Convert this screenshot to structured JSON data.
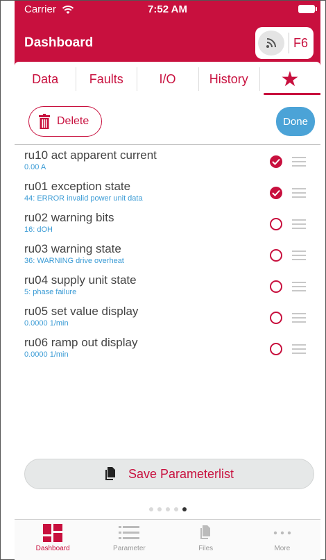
{
  "status_bar": {
    "carrier": "Carrier",
    "time": "7:52 AM"
  },
  "header": {
    "title": "Dashboard",
    "device_button": "F6"
  },
  "tabs": [
    {
      "label": "Data"
    },
    {
      "label": "Faults"
    },
    {
      "label": "I/O"
    },
    {
      "label": "History"
    },
    {
      "label": "★",
      "active": true
    }
  ],
  "toolbar": {
    "delete_label": "Delete",
    "done_label": "Done"
  },
  "items": [
    {
      "title": "ru10 act apparent current",
      "value": "0.00 A",
      "selected": true
    },
    {
      "title": "ru01 exception state",
      "value": "44: ERROR invalid power unit data",
      "selected": true
    },
    {
      "title": "ru02 warning bits",
      "value": "16: dOH",
      "selected": false
    },
    {
      "title": "ru03 warning state",
      "value": "36: WARNING drive overheat",
      "selected": false
    },
    {
      "title": "ru04 supply unit state",
      "value": "5: phase failure",
      "selected": false
    },
    {
      "title": "ru05 set value display",
      "value": "0.0000 1/min",
      "selected": false
    },
    {
      "title": "ru06 ramp out display",
      "value": "0.0000 1/min",
      "selected": false
    }
  ],
  "save_button": {
    "label": "Save Parameterlist"
  },
  "pager": {
    "pages": 5,
    "current": 5
  },
  "bottom_tabs": [
    {
      "label": "Dashboard",
      "icon": "dashboard-icon",
      "active": true
    },
    {
      "label": "Parameter",
      "icon": "list-icon"
    },
    {
      "label": "Files",
      "icon": "files-icon"
    },
    {
      "label": "More",
      "icon": "more-icon"
    }
  ],
  "colors": {
    "brand": "#c8103e",
    "accent_blue": "#4ba3d7",
    "value_blue": "#3a9bd5"
  }
}
